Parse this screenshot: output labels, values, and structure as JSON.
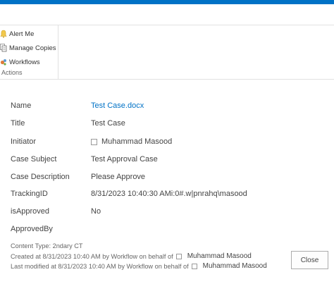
{
  "ribbon": {
    "items": [
      {
        "label": "Alert Me",
        "icon": "bell-icon"
      },
      {
        "label": "Manage Copies",
        "icon": "copies-icon"
      },
      {
        "label": "Workflows",
        "icon": "workflow-icon"
      }
    ],
    "group_label": "Actions"
  },
  "fields": [
    {
      "label": "Name",
      "value": "Test Case.docx"
    },
    {
      "label": "Title",
      "value": "Test Case"
    },
    {
      "label": "Initiator",
      "value": "Muhammad Masood"
    },
    {
      "label": "Case Subject",
      "value": "Test Approval Case"
    },
    {
      "label": "Case Description",
      "value": "Please Approve"
    },
    {
      "label": "TrackingID",
      "value": "8/31/2023 10:40:30 AMi:0#.w|pnrahq\\masood"
    },
    {
      "label": "isApproved",
      "value": "No"
    },
    {
      "label": "ApprovedBy",
      "value": ""
    }
  ],
  "footer": {
    "content_type": "Content Type: 2ndary CT",
    "created": "Created at 8/31/2023 10:40 AM  by Workflow on behalf of",
    "created_by": "Muhammad Masood",
    "modified": "Last modified at 8/31/2023 10:40 AM  by Workflow on behalf of",
    "modified_by": "Muhammad Masood"
  },
  "buttons": {
    "close": "Close"
  },
  "colors": {
    "accent": "#0072c6"
  }
}
